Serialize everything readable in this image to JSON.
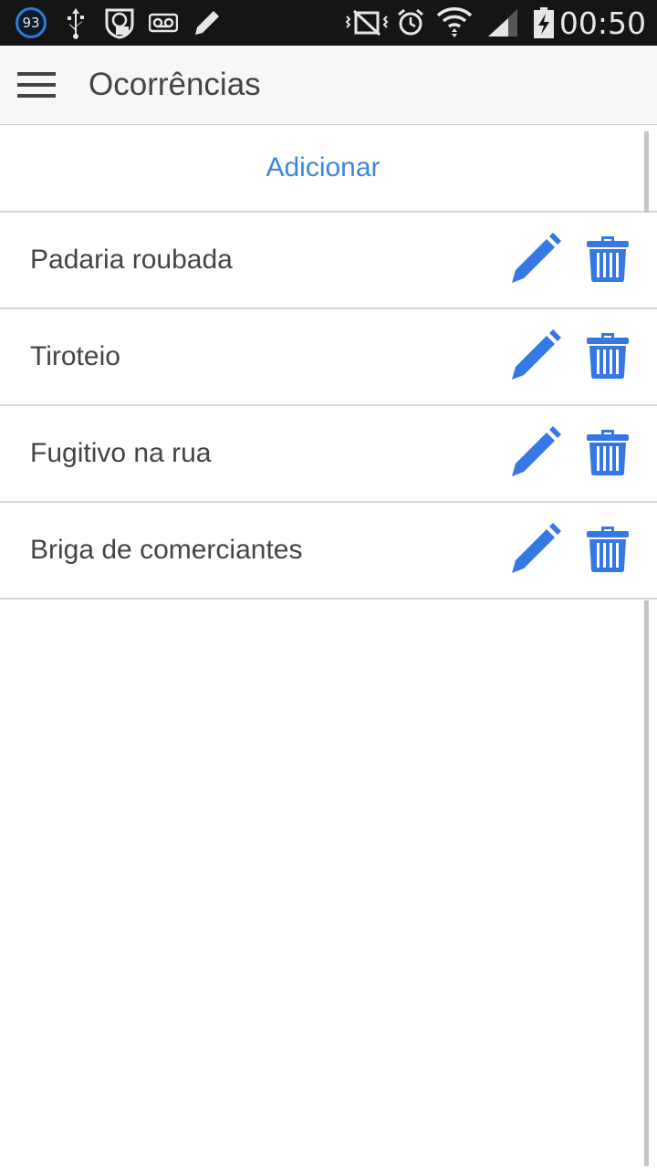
{
  "status_bar": {
    "notification_count": "93",
    "time": "00:50",
    "icons": [
      "notification-count-badge",
      "usb-icon",
      "speedometer-mail-icon",
      "voicemail-icon",
      "pencil-icon",
      "silent-mode-icon",
      "alarm-icon",
      "wifi-icon",
      "signal-icon",
      "battery-charging-icon"
    ]
  },
  "app_bar": {
    "title": "Ocorrências",
    "menu_icon": "hamburger-menu-icon"
  },
  "add_button": {
    "label": "Adicionar"
  },
  "items": [
    {
      "label": "Padaria roubada"
    },
    {
      "label": "Tiroteio"
    },
    {
      "label": "Fugitivo na rua"
    },
    {
      "label": "Briga de comerciantes"
    }
  ],
  "colors": {
    "accent": "#3d86e0",
    "icon_blue": "#3578e5",
    "status_bar": "#151515",
    "app_bar": "#f7f7f7",
    "text": "#444444",
    "divider": "#d6d6d6"
  }
}
